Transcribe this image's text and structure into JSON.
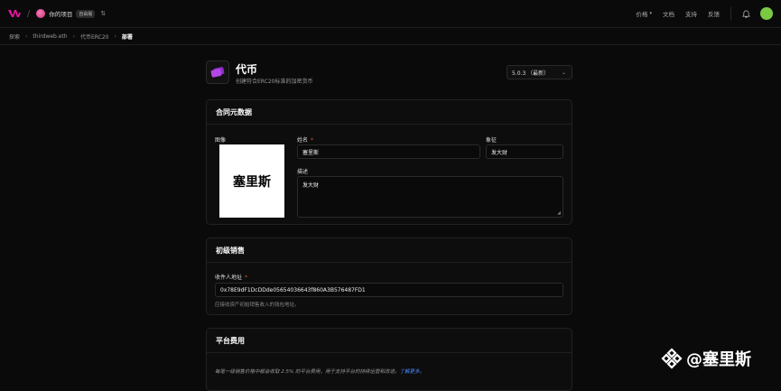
{
  "topbar": {
    "project_name": "你的项目",
    "project_badge": "自由版",
    "nav": [
      "价格",
      "文档",
      "支持",
      "反馈"
    ]
  },
  "breadcrumb": [
    "探索",
    "thirdweb.eth",
    "代币ERC20",
    "部署"
  ],
  "header": {
    "title": "代币",
    "subtitle": "创建符合ERC20标准的加密货币",
    "version": "5.0.3 （最新）"
  },
  "metadata": {
    "section_title": "合同元数据",
    "image_label": "图像",
    "image_text": "塞里斯",
    "name_label": "姓名",
    "name_value": "塞里斯",
    "symbol_label": "象征",
    "symbol_value": "发大财",
    "description_label": "描述",
    "description_value": "发大财"
  },
  "primary_sale": {
    "section_title": "初级销售",
    "recipient_label": "收件人地址",
    "recipient_value": "0x78E9dF1DcDDde05654036643f860A3B576487FD1",
    "hint": "应接收资产初始销售收入的钱包地址。"
  },
  "platform_fees": {
    "section_title": "平台费用",
    "note": "每笔一级销售价格中都会收取 2.5% 的平台费用，用于支持平台的持续运营和改进。",
    "link": "了解更多。"
  },
  "watermark": "@塞里斯",
  "colors": {
    "accent_link": "#4e8cff",
    "required": "#e0503a",
    "avatar": "#7ac943"
  }
}
